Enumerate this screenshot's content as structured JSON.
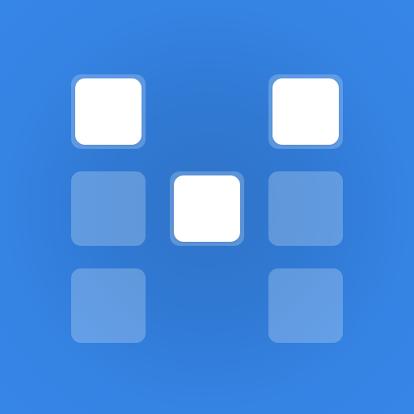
{
  "app_icon": {
    "name": "grid-pattern-icon",
    "background_color": "#3583e3",
    "grid": {
      "rows": 3,
      "cols": 3,
      "cells": [
        [
          "on",
          "empty",
          "on"
        ],
        [
          "off",
          "on",
          "off"
        ],
        [
          "off",
          "empty",
          "off"
        ]
      ]
    },
    "colors": {
      "active_cell": "#ffffff",
      "inactive_cell": "rgba(255,255,255,0.24)"
    }
  }
}
